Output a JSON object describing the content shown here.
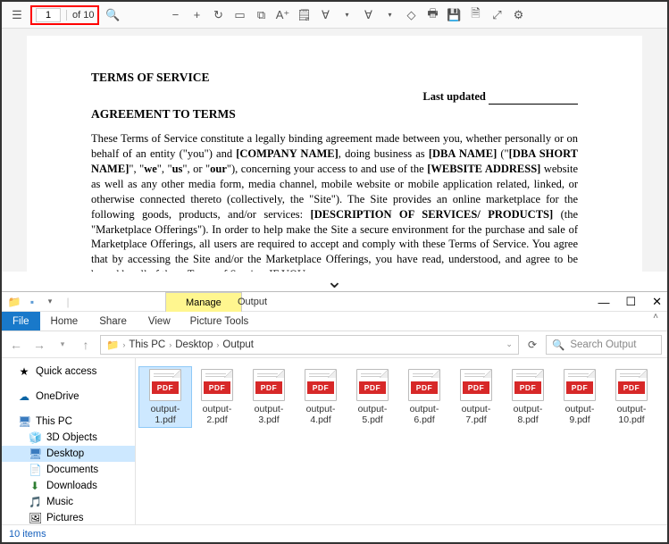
{
  "pdf": {
    "page_current": "1",
    "page_of": "of 10",
    "doc": {
      "h1": "TERMS OF SERVICE",
      "updated_label": "Last updated ",
      "h2": "AGREEMENT TO TERMS",
      "para1_a": "These Terms of Service constitute a legally binding agreement made between you, whether personally or on behalf of an entity (\"you\") and ",
      "para1_b": "[COMPANY NAME]",
      "para1_c": ", doing business as ",
      "para1_d": "[DBA NAME]",
      "para1_e": " (\"",
      "para1_f": "[DBA SHORT NAME]",
      "para1_g": "\", \"",
      "para1_h": "we",
      "para1_i": "\", \"",
      "para1_j": "us",
      "para1_k": "\", or \"",
      "para1_l": "our",
      "para1_m": "\"), concerning your access to and use of the ",
      "para1_n": "[WEBSITE ADDRESS]",
      "para1_o": " website as well as any other media form, media channel, mobile website or mobile application related, linked, or otherwise connected thereto (collectively, the \"Site\"). The Site provides an online marketplace for the following goods, products, and/or services: ",
      "para1_p": "[DESCRIPTION OF SERVICES/ PRODUCTS]",
      "para1_q": " (the \"Marketplace Offerings\"). In order to help make the Site a secure environment for the purchase and sale of Marketplace Offerings, all users are required to accept and comply with these Terms of Service. You agree that by accessing the Site and/or the Marketplace Offerings, you have read, understood, and agree to be bound by all of these Terms of Service. IF YOU"
    }
  },
  "explorer": {
    "title": "Output",
    "contextual_tab": "Manage",
    "tabs": {
      "file": "File",
      "home": "Home",
      "share": "Share",
      "view": "View",
      "pictools": "Picture Tools"
    },
    "breadcrumb": [
      "This PC",
      "Desktop",
      "Output"
    ],
    "search_placeholder": "Search Output",
    "sidebar": {
      "quick": "Quick access",
      "onedrive": "OneDrive",
      "thispc": "This PC",
      "objects": "3D Objects",
      "desktop": "Desktop",
      "documents": "Documents",
      "downloads": "Downloads",
      "music": "Music",
      "pictures": "Pictures"
    },
    "files": [
      {
        "name": "output-1.pdf"
      },
      {
        "name": "output-2.pdf"
      },
      {
        "name": "output-3.pdf"
      },
      {
        "name": "output-4.pdf"
      },
      {
        "name": "output-5.pdf"
      },
      {
        "name": "output-6.pdf"
      },
      {
        "name": "output-7.pdf"
      },
      {
        "name": "output-8.pdf"
      },
      {
        "name": "output-9.pdf"
      },
      {
        "name": "output-10.pdf"
      }
    ],
    "badge": "PDF",
    "status": "10 items"
  }
}
